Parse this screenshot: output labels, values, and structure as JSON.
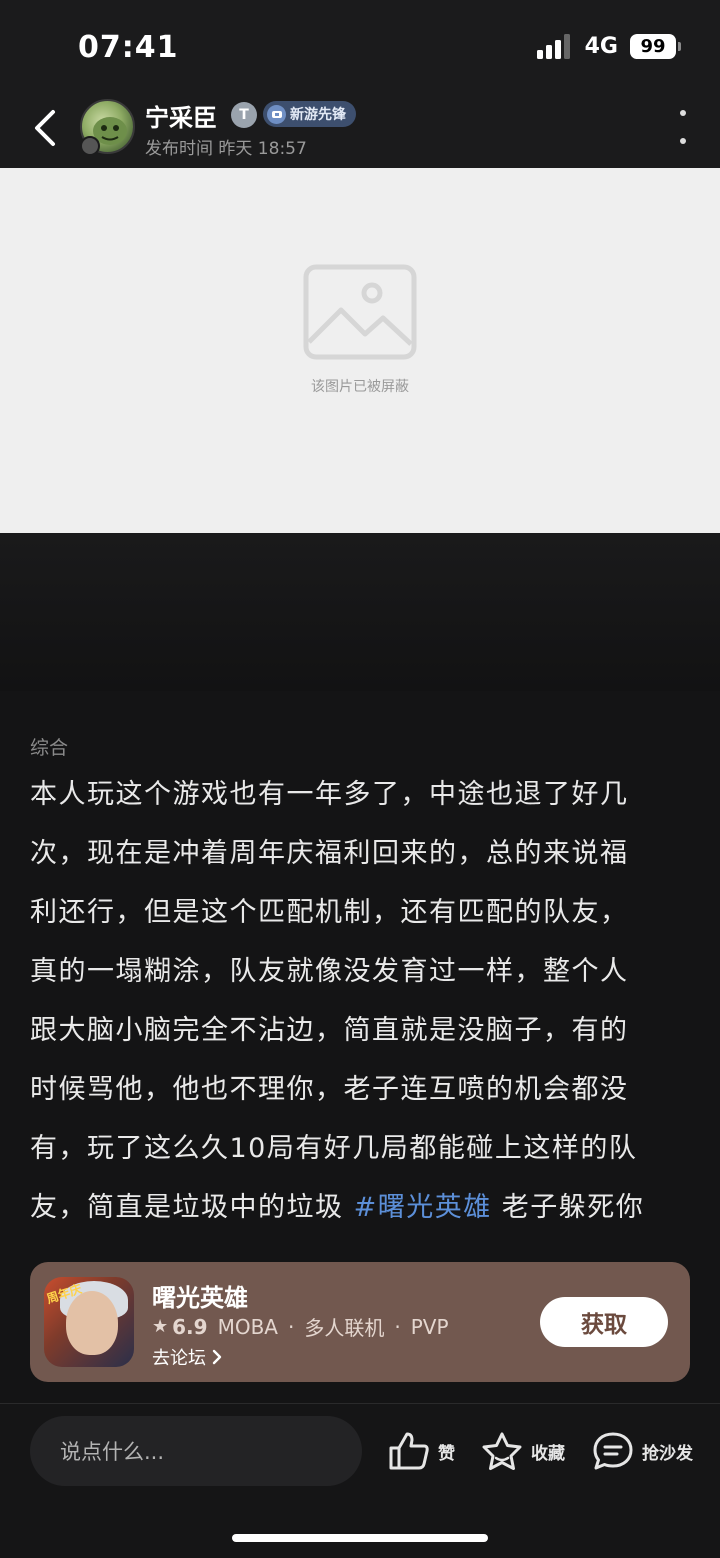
{
  "status_bar": {
    "time": "07:41",
    "network": "4G",
    "battery": "99"
  },
  "header": {
    "username": "宁采臣",
    "verify_badge": "T",
    "tag": "新游先锋",
    "post_time": "发布时间 昨天 18:57",
    "icons": [
      "back-arrow-icon",
      "more-vertical-icon"
    ]
  },
  "image": {
    "blocked_text": "该图片已被屏蔽"
  },
  "post": {
    "category": "综合",
    "lines": [
      "本人玩这个游戏也有一年多了，中途也退了好几",
      "次，现在是冲着周年庆福利回来的，总的来说福",
      "利还行，但是这个匹配机制，还有匹配的队友，",
      "真的一塌糊涂，队友就像没发育过一样，整个人",
      "跟大脑小脑完全不沾边，简直就是没脑子，有的",
      "时候骂他，他也不理你，老子连互喷的机会都没",
      "有，玩了这么久10局有好几局都能碰上这样的队"
    ],
    "last_line_before": "友，简直是垃圾中的垃圾 ",
    "hashtag": "#曙光英雄",
    "last_line_after": " 老子躲死你"
  },
  "game_card": {
    "name": "曙光英雄",
    "icon_tag": "周年庆",
    "rating": "6.9",
    "genres": [
      "MOBA",
      "多人联机",
      "PVP"
    ],
    "separator": "·",
    "forum_link": "去论坛",
    "get_label": "获取",
    "card_color": "#72584f"
  },
  "bottom_bar": {
    "comment_placeholder": "说点什么...",
    "like_label": "赞",
    "fav_label": "收藏",
    "sofa_label": "抢沙发"
  },
  "colors": {
    "background": "#141415",
    "hashtag": "#5c8fd8",
    "tag_badge": "#3d4f6e"
  }
}
